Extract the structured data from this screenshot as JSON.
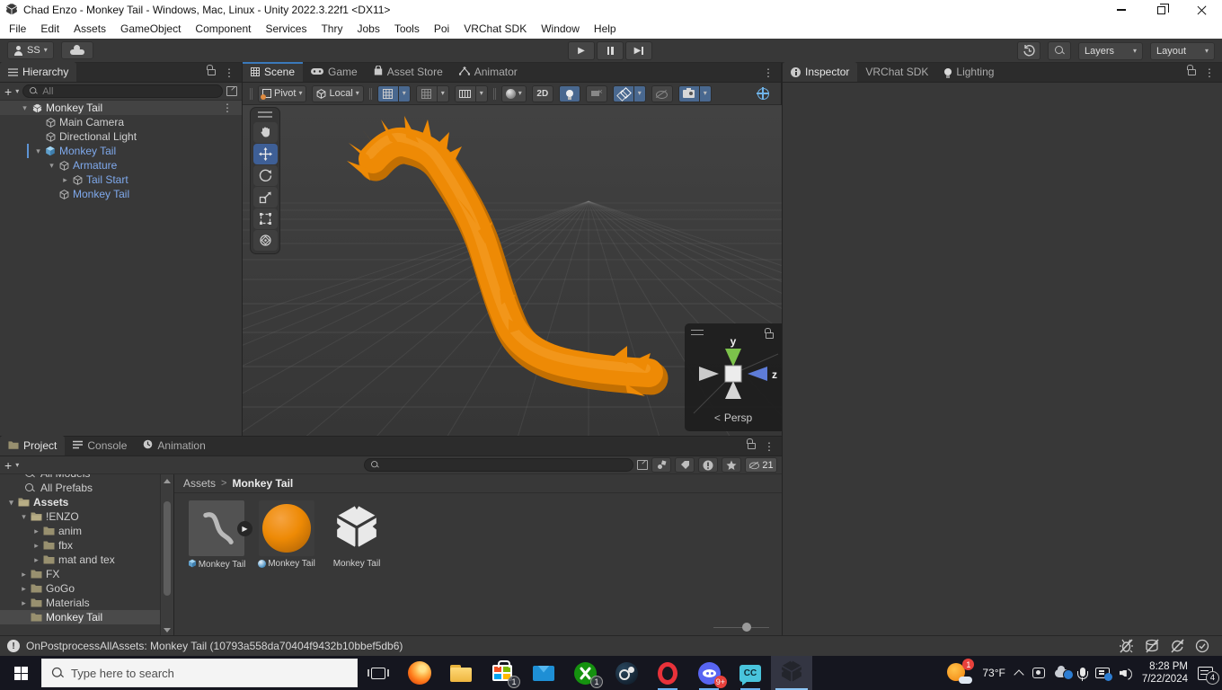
{
  "window": {
    "title": "Chad Enzo - Monkey Tail - Windows, Mac, Linux - Unity 2022.3.22f1 <DX11>"
  },
  "menu": [
    "File",
    "Edit",
    "Assets",
    "GameObject",
    "Component",
    "Services",
    "Thry",
    "Jobs",
    "Tools",
    "Poi",
    "VRChat SDK",
    "Window",
    "Help"
  ],
  "toolbar": {
    "account": "SS",
    "layers": "Layers",
    "layout": "Layout"
  },
  "hierarchy": {
    "tab": "Hierarchy",
    "search_placeholder": "All",
    "rows": [
      {
        "label": "Monkey Tail",
        "depth": 0,
        "icon": "scene",
        "arrow": "open",
        "root": true
      },
      {
        "label": "Main Camera",
        "depth": 1,
        "icon": "cube"
      },
      {
        "label": "Directional Light",
        "depth": 1,
        "icon": "cube"
      },
      {
        "label": "Monkey Tail",
        "depth": 1,
        "icon": "prefab",
        "arrow": "open",
        "prefab": true,
        "marker": true
      },
      {
        "label": "Armature",
        "depth": 2,
        "icon": "cube",
        "arrow": "open",
        "prefab": true
      },
      {
        "label": "Tail Start",
        "depth": 3,
        "icon": "cube",
        "arrow": "closed",
        "prefab": true
      },
      {
        "label": "Monkey Tail",
        "depth": 2,
        "icon": "cube",
        "prefab": true
      }
    ]
  },
  "scene": {
    "tabs": [
      {
        "label": "Scene",
        "icon": "grid",
        "active": true
      },
      {
        "label": "Game",
        "icon": "gamepad"
      },
      {
        "label": "Asset Store",
        "icon": "bag"
      },
      {
        "label": "Animator",
        "icon": "animator"
      }
    ],
    "pivot": "Pivot",
    "local": "Local",
    "btn_2d": "2D",
    "gizmo": {
      "y": "y",
      "z": "z",
      "persp": "Persp"
    }
  },
  "inspector": {
    "tabs": [
      {
        "label": "Inspector",
        "icon": "info",
        "active": true
      },
      {
        "label": "VRChat SDK"
      },
      {
        "label": "Lighting",
        "icon": "bulb"
      }
    ]
  },
  "project": {
    "tabs": [
      {
        "label": "Project",
        "icon": "folder",
        "active": true
      },
      {
        "label": "Console",
        "icon": "console"
      },
      {
        "label": "Animation",
        "icon": "clock"
      }
    ],
    "tree": [
      {
        "label": "All Models",
        "kind": "search",
        "cut": true
      },
      {
        "label": "All Prefabs",
        "kind": "search"
      },
      {
        "label": "Assets",
        "depth": 0,
        "icon": "folder-open",
        "arrow": "open",
        "bold": true
      },
      {
        "label": "!ENZO",
        "depth": 1,
        "icon": "folder-open",
        "arrow": "open"
      },
      {
        "label": "anim",
        "depth": 2,
        "icon": "folder",
        "arrow": "closed"
      },
      {
        "label": "fbx",
        "depth": 2,
        "icon": "folder",
        "arrow": "closed"
      },
      {
        "label": "mat and tex",
        "depth": 2,
        "icon": "folder",
        "arrow": "closed"
      },
      {
        "label": "FX",
        "depth": 1,
        "icon": "folder",
        "arrow": "closed"
      },
      {
        "label": "GoGo",
        "depth": 1,
        "icon": "folder",
        "arrow": "closed"
      },
      {
        "label": "Materials",
        "depth": 1,
        "icon": "folder",
        "arrow": "closed"
      },
      {
        "label": "Monkey Tail",
        "depth": 1,
        "icon": "folder",
        "selected": true
      }
    ],
    "breadcrumb": {
      "root": "Assets",
      "current": "Monkey Tail"
    },
    "assets": [
      {
        "label": "Monkey Tail",
        "type": "model"
      },
      {
        "label": "Monkey Tail",
        "type": "material"
      },
      {
        "label": "Monkey Tail",
        "type": "package"
      }
    ],
    "hidden_count": "21"
  },
  "status": {
    "message": "OnPostprocessAllAssets: Monkey Tail (10793a558da70404f9432b10bbef5db6)"
  },
  "taskbar": {
    "search_placeholder": "Type here to search",
    "cc_label": "CC",
    "weather_temp": "73°F",
    "time": "8:28 PM",
    "date": "7/22/2024",
    "badges": {
      "weather": "1",
      "store": "1",
      "xbox": "1",
      "discord": "9+",
      "notifications": "4"
    }
  },
  "icons": {
    "dropdown": "▾",
    "expanded": "▾",
    "collapsed": "▸",
    "more": "⋮",
    "play": "▶",
    "chevron": ">",
    "lt": "<",
    "exclaim": "!"
  },
  "colors": {
    "orange": "#ee8a05",
    "orange_dark": "#c26f02",
    "orange_hi": "#f7a435",
    "prefab_blue": "#7fa9ec",
    "tab_accent": "#3a79bb",
    "toggle_blue": "#49688f",
    "taskbar_accent": "#6cb2f0",
    "badge_red": "#e8413c"
  }
}
